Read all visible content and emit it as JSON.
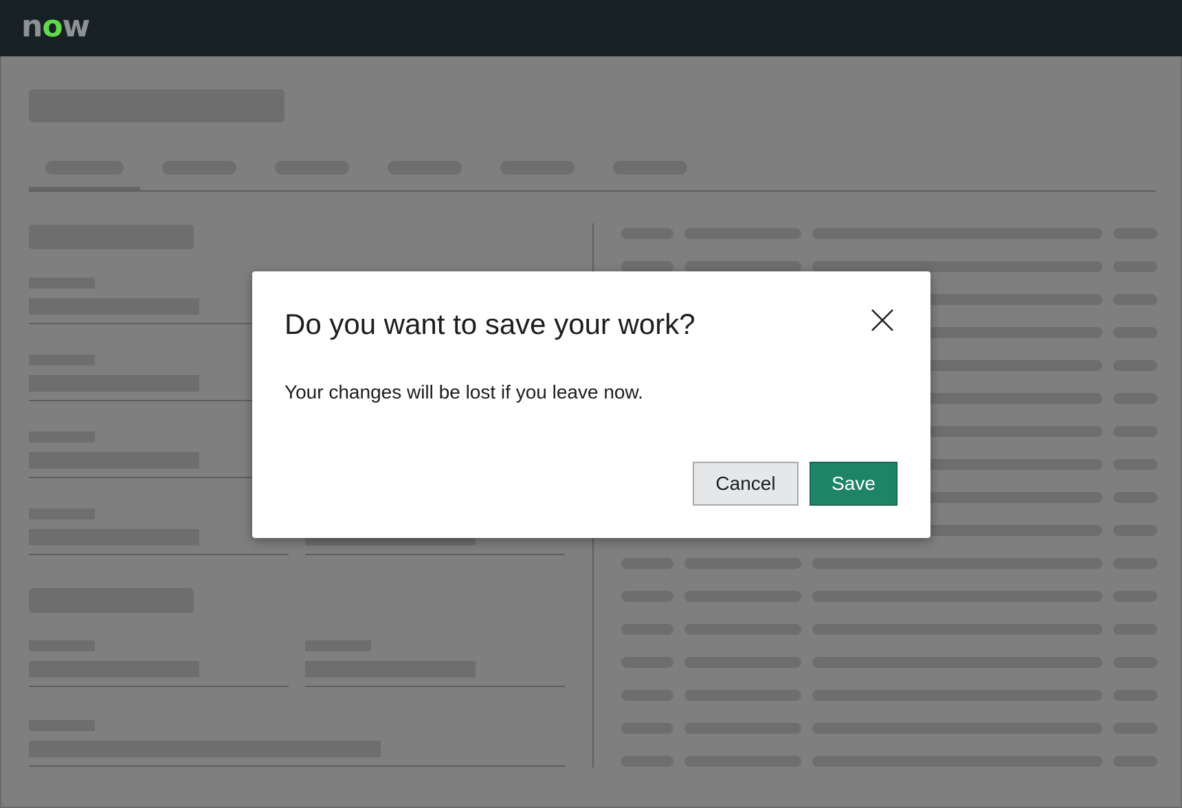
{
  "app": {
    "logo_text_pre": "n",
    "logo_text_o": "o",
    "logo_text_post": "w",
    "brand_color": "#62d84e"
  },
  "dialog": {
    "title": "Do you want to save your work?",
    "message": "Your changes will be lost if you leave now.",
    "close_icon": "close-icon",
    "cancel_label": "Cancel",
    "save_label": "Save",
    "save_color": "#1d8466"
  }
}
